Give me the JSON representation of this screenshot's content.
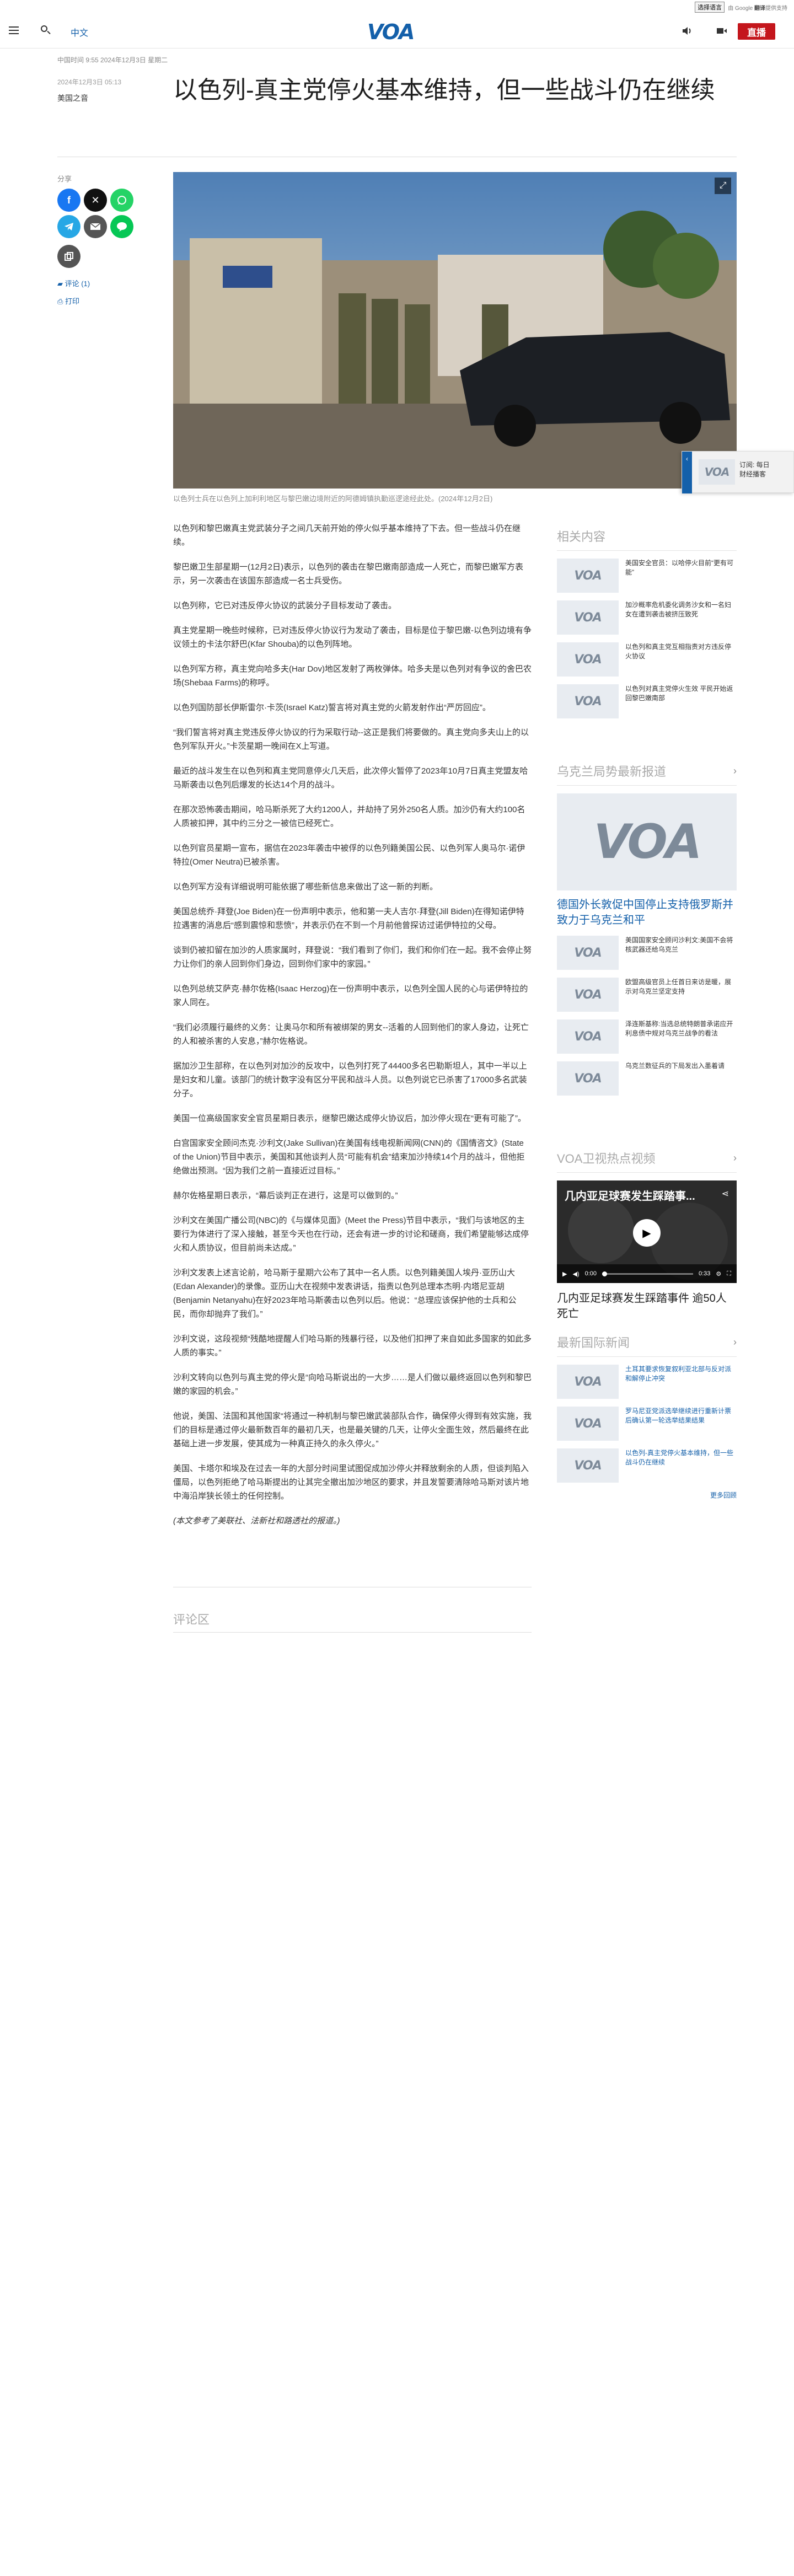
{
  "translate": {
    "select_label": "选择语言",
    "powered_by": "由 Google",
    "brand": "翻译",
    "suffix": "提供支持"
  },
  "header": {
    "lang_link": "中文",
    "logo": "VOA",
    "live_label": "直播"
  },
  "article": {
    "dateline": "中国时间 9:55 2024年12月3日 星期二",
    "pub_date": "2024年12月3日 05:13",
    "section": "美国之音",
    "headline": "以色列-真主党停火基本维持，但一些战斗仍在继续",
    "caption": "以色列士兵在以色列上加利利地区与黎巴嫩边境附近的阿德姆镇执勤巡逻途经此处。(2024年12月2日)",
    "share_label": "分享",
    "comments_link": "评论 (1)",
    "print_link": "打印",
    "paragraphs": [
      "以色列和黎巴嫩真主党武装分子之间几天前开始的停火似乎基本维持了下去。但一些战斗仍在继续。",
      "黎巴嫩卫生部星期一(12月2日)表示，以色列的袭击在黎巴嫩南部造成一人死亡，而黎巴嫩军方表示，另一次袭击在该国东部造成一名士兵受伤。",
      "以色列称，它已对违反停火协议的武装分子目标发动了袭击。",
      "真主党星期一晚些时候称，已对违反停火协议行为发动了袭击，目标是位于黎巴嫩-以色列边境有争议领土的卡法尔舒巴(Kfar Shouba)的以色列阵地。",
      "以色列军方称，真主党向哈多夫(Har Dov)地区发射了两枚弹体。哈多夫是以色列对有争议的舍巴农场(Shebaa Farms)的称呼。",
      "以色列国防部长伊斯雷尔·卡茨(Israel Katz)誓言将对真主党的火箭发射作出“严厉回应”。",
      "“我们誓言将对真主党违反停火协议的行为采取行动--这正是我们将要做的。真主党向多夫山上的以色列军队开火。”卡茨星期一晚间在X上写道。",
      "最近的战斗发生在以色列和真主党同意停火几天后，此次停火暂停了2023年10月7日真主党盟友哈马斯袭击以色列后爆发的长达14个月的战斗。",
      "在那次恐怖袭击期间，哈马斯杀死了大约1200人，并劫持了另外250名人质。加沙仍有大约100名人质被扣押，其中约三分之一被信已经死亡。",
      "以色列官员星期一宣布，据信在2023年袭击中被俘的以色列籍美国公民、以色列军人奥马尔·诺伊特拉(Omer Neutra)已被杀害。",
      "以色列军方没有详细说明可能依据了哪些新信息来做出了这一新的判断。",
      "美国总统乔·拜登(Joe Biden)在一份声明中表示，他和第一夫人吉尔·拜登(Jill Biden)在得知诺伊特拉遇害的消息后“感到震惊和悲愤”，并表示仍在不到一个月前他曾探访过诺伊特拉的父母。",
      "谈到仍被扣留在加沙的人质家属时，拜登说：“我们看到了你们，我们和你们在一起。我不会停止努力让你们的亲人回到你们身边，回到你们家中的家园。”",
      "以色列总统艾萨克·赫尔佐格(Isaac Herzog)在一份声明中表示，以色列全国人民的心与诺伊特拉的家人同在。",
      "“我们必须履行最终的义务：让奥马尔和所有被绑架的男女--活着的人回到他们的家人身边，让死亡的人和被杀害的人安息，”赫尔佐格说。",
      "据加沙卫生部称，在以色列对加沙的反攻中，以色列打死了44400多名巴勒斯坦人，其中一半以上是妇女和儿童。该部门的统计数字没有区分平民和战斗人员。以色列说它已杀害了17000多名武装分子。",
      "美国一位高级国家安全官员星期日表示，继黎巴嫩达成停火协议后，加沙停火现在“更有可能了”。",
      "白宫国家安全顾问杰克·沙利文(Jake Sullivan)在美国有线电视新闻网(CNN)的《国情咨文》(State of the Union)节目中表示，美国和其他谈判人员“可能有机会”结束加沙持续14个月的战斗，但他拒绝做出预测。“因为我们之前一直接近过目标。”",
      "赫尔佐格星期日表示，“幕后谈判正在进行，这是可以做到的。”",
      "沙利文在美国广播公司(NBC)的《与媒体见面》(Meet the Press)节目中表示，“我们与该地区的主要行为体进行了深入接触，甚至今天也在行动，还会有进一步的讨论和磋商，我们希望能够达成停火和人质协议，但目前尚未达成。”",
      "沙利文发表上述言论前，哈马斯于星期六公布了其中一名人质。以色列籍美国人埃丹·亚历山大(Edan Alexander)的录像。亚历山大在视频中发表讲话，指责以色列总理本杰明·内塔尼亚胡(Benjamin Netanyahu)在好2023年哈马斯袭击以色列以后。他说：“总理应该保护他的士兵和公民，而你却抛弃了我们。”",
      "沙利文说，这段视频“残酷地提醒人们哈马斯的残暴行径，以及他们扣押了来自如此多国家的如此多人质的事实。”",
      "沙利文转向以色列与真主党的停火是“向哈马斯说出的一大步……是人们做以最终返回以色列和黎巴嫩的家园的机会。”",
      "他说，美国、法国和其他国家“将通过一种机制与黎巴嫩武装部队合作，确保停火得到有效实施，我们的目标是通过停火最新数百年的最初几天，也是最关键的几天，让停火全面生效，然后最终在此基础上进一步发展，使其成为一种真正持久的永久停火。”",
      "美国、卡塔尔和埃及在过去一年的大部分时间里试图促成加沙停火并释放剩余的人质，但谈判陷入僵局，以色列拒绝了哈马斯提出的让其完全撤出加沙地区的要求，并且发誓要清除哈马斯对该片地中海沿岸狭长领土的任何控制。"
    ],
    "note": "(本文参考了美联社、法新社和路透社的报道。)",
    "comments_title": "评论区"
  },
  "sidebar": {
    "related_title": "相关内容",
    "related": [
      "美国安全官员：以哈停火目前“更有可能”",
      "加沙概率危机委化调务沙女和一名妇女在遭到袭击被挤压致死",
      "以色列和真主党互相指责对方违反停火协议",
      "以色列对真主党停火生效 平民开始返回黎巴嫩南部"
    ],
    "ukraine_title": "乌克兰局势最新报道",
    "ukraine_feature": "德国外长敦促中国停止支持俄罗斯并致力于乌克兰和平",
    "ukraine": [
      "美国国家安全顾问沙利文:美国不会将核武器还给乌克兰",
      "欧盟高级官员上任首日来访是暖，展示对乌克兰坚定支持",
      "泽连斯基称:当选总统特朗普承诺应开利息债中规对乌克兰战争的看法",
      "乌克兰数征兵的下局发出入墨着请"
    ],
    "video_title": "VOA卫视热点视频",
    "video_overlay": "几内亚足球赛发生踩踏事...",
    "video_time_cur": "0:00",
    "video_time_total": "0:33",
    "video_caption": "几内亚足球赛发生踩踏事件 逾50人死亡",
    "intl_title": "最新国际新闻",
    "intl": [
      "土耳其要求恢复叙利亚北部与反对派和解停止冲突",
      "罗马尼亚党派选举继续进行重新计票后确认第一轮选举结果结果",
      "以色列-真主党停火基本维持，但一些战斗仍在继续"
    ],
    "more": "更多回顾"
  },
  "sticky": {
    "tab_icon": "chevron-left",
    "text_line1": "订阅: 每日",
    "text_line2": "财经播客"
  },
  "colors": {
    "brand": "#1460aa",
    "live": "#c4161c"
  }
}
